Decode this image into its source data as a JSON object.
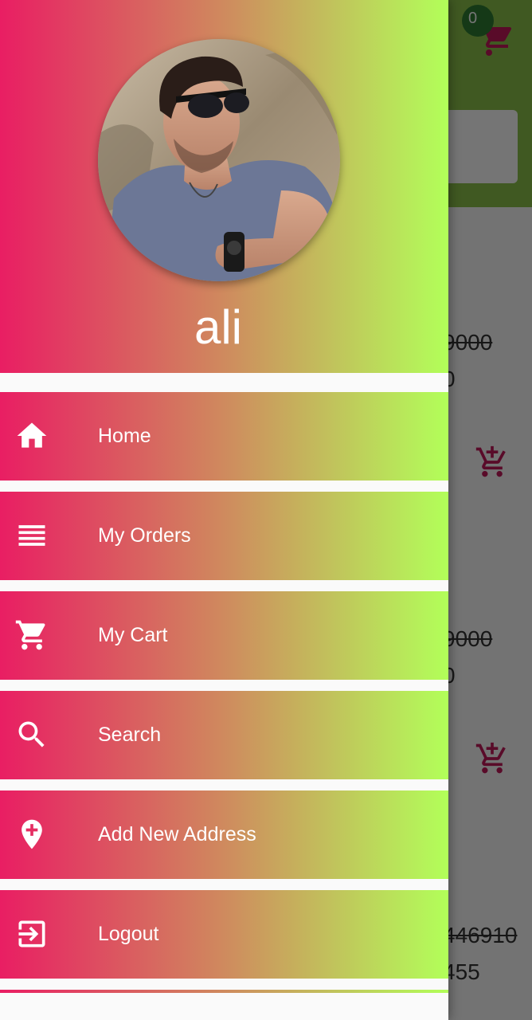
{
  "background": {
    "cart_badge_count": "0",
    "prices": [
      {
        "old": "9000",
        "new": "0"
      },
      {
        "old": "9000",
        "new": "0"
      },
      {
        "old": "446910",
        "new": "455"
      }
    ]
  },
  "drawer": {
    "user_name": "ali",
    "menu": [
      {
        "label": "Home",
        "icon": "home-icon"
      },
      {
        "label": "My Orders",
        "icon": "list-icon"
      },
      {
        "label": "My Cart",
        "icon": "cart-icon"
      },
      {
        "label": "Search",
        "icon": "search-icon"
      },
      {
        "label": "Add New Address",
        "icon": "add-location-icon"
      },
      {
        "label": "Logout",
        "icon": "logout-icon"
      }
    ]
  },
  "colors": {
    "gradient_start": "#e91e63",
    "gradient_end": "#b2ff59",
    "appbar": "#8bc34a",
    "accent_pink": "#c2185b",
    "badge": "#2e7d32"
  }
}
